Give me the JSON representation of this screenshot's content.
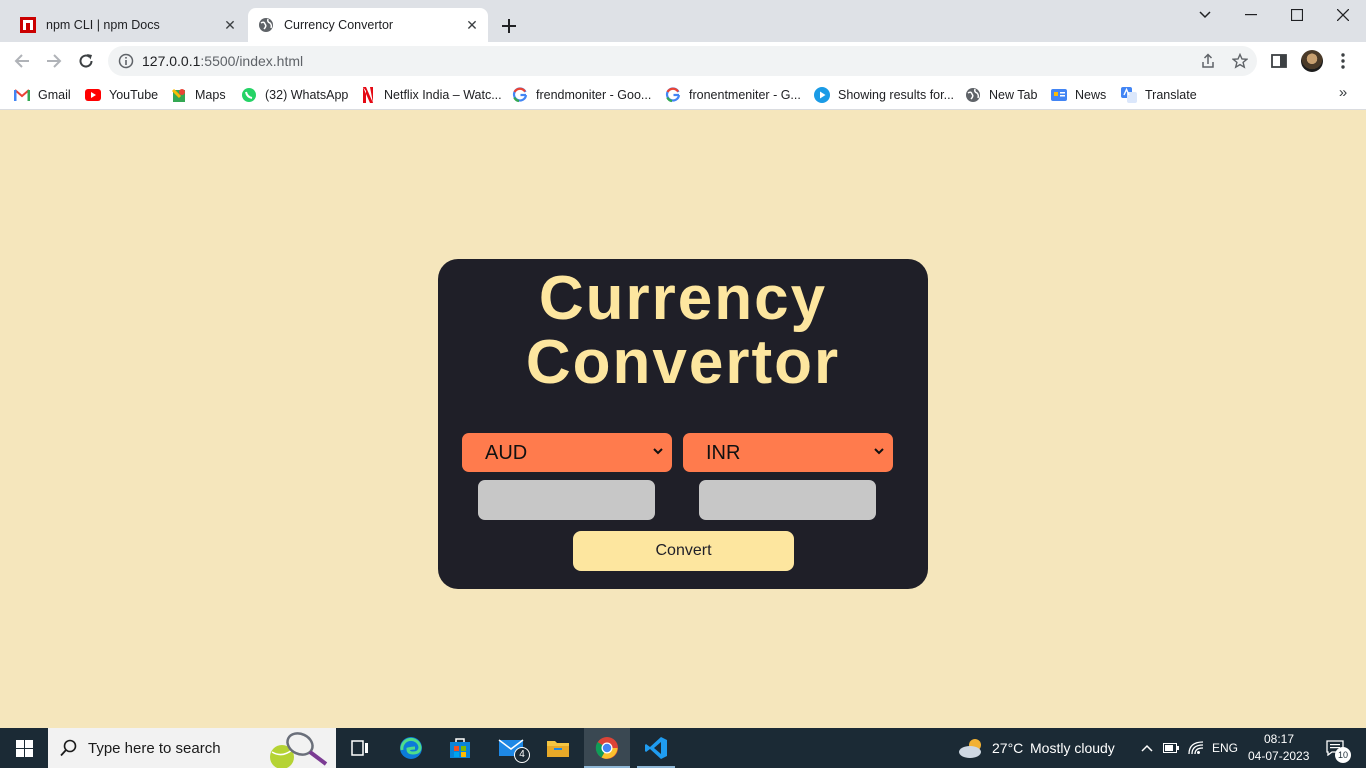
{
  "browser": {
    "tabs": [
      {
        "title": "npm CLI | npm Docs",
        "active": false
      },
      {
        "title": "Currency Convertor",
        "active": true
      }
    ],
    "address": {
      "host": "127.0.0.1",
      "rest": ":5500/index.html"
    },
    "bookmarks": [
      {
        "label": "Gmail",
        "icon": "gmail-icon"
      },
      {
        "label": "YouTube",
        "icon": "youtube-icon"
      },
      {
        "label": "Maps",
        "icon": "maps-icon"
      },
      {
        "label": "(32) WhatsApp",
        "icon": "whatsapp-icon"
      },
      {
        "label": "Netflix India – Watc...",
        "icon": "netflix-icon"
      },
      {
        "label": "frendmoniter - Goo...",
        "icon": "google-icon"
      },
      {
        "label": "fronentmeniter - G...",
        "icon": "google-icon"
      },
      {
        "label": "Showing results for...",
        "icon": "play-icon"
      },
      {
        "label": "New Tab",
        "icon": "globe-icon"
      },
      {
        "label": "News",
        "icon": "news-icon"
      },
      {
        "label": "Translate",
        "icon": "translate-icon"
      }
    ]
  },
  "page": {
    "title_line1": "Currency",
    "title_line2": "Convertor",
    "from_currency": "AUD",
    "to_currency": "INR",
    "from_amount": "",
    "to_amount": "",
    "convert_label": "Convert",
    "colors": {
      "background": "#f5e6bc",
      "card": "#1f1f28",
      "accent_text": "#fde69f",
      "select": "#ff7b4d",
      "input": "#c7c7c7"
    }
  },
  "taskbar": {
    "search_placeholder": "Type here to search",
    "mail_badge": "4",
    "weather_temp": "27°C",
    "weather_desc": "Mostly cloudy",
    "language": "ENG",
    "time": "08:17",
    "date": "04-07-2023",
    "notification_count": "10"
  }
}
